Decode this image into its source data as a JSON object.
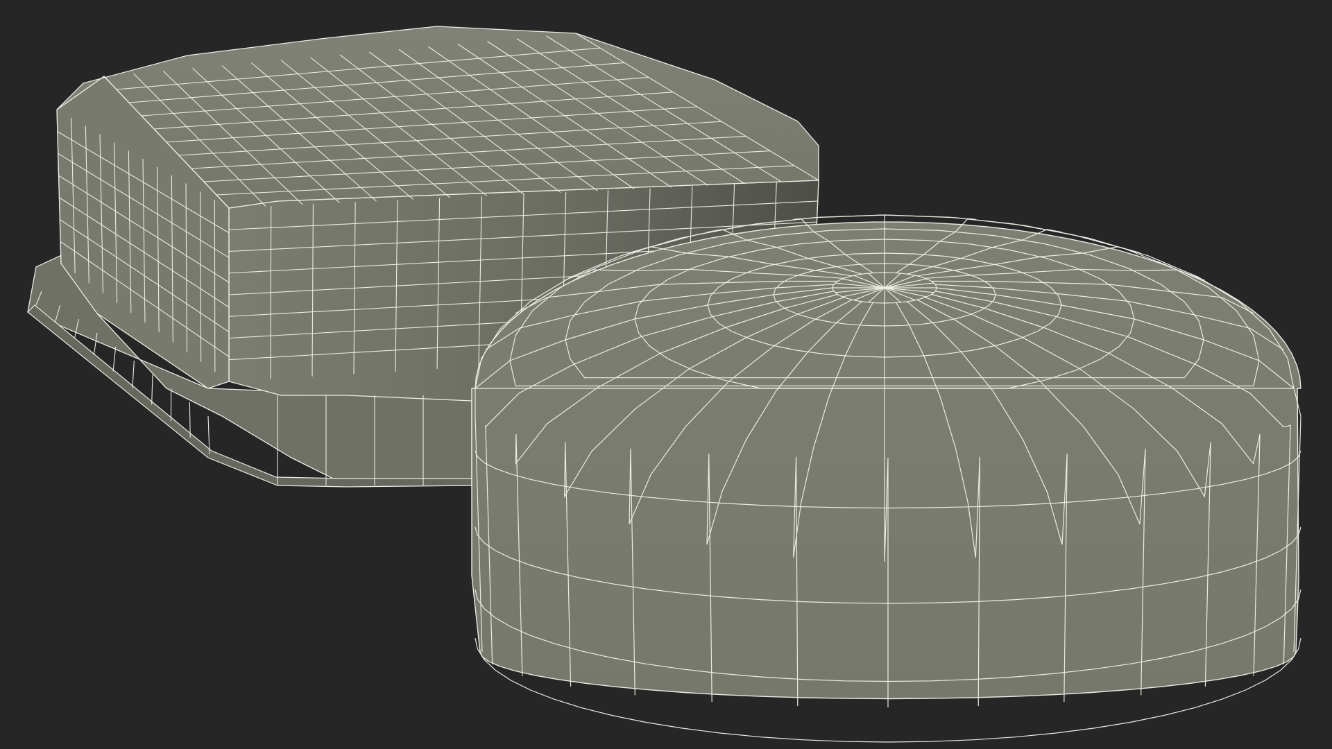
{
  "scene": {
    "background": "#262626",
    "mesh_fill": "#7a7b6f",
    "mesh_shadow": "#5d5e55",
    "wire_color": "#ecece4",
    "objects": [
      {
        "name": "rounded-rectangular-box",
        "icon": "wireframe-box-icon"
      },
      {
        "name": "dome-cap",
        "icon": "wireframe-dome-icon"
      }
    ]
  }
}
